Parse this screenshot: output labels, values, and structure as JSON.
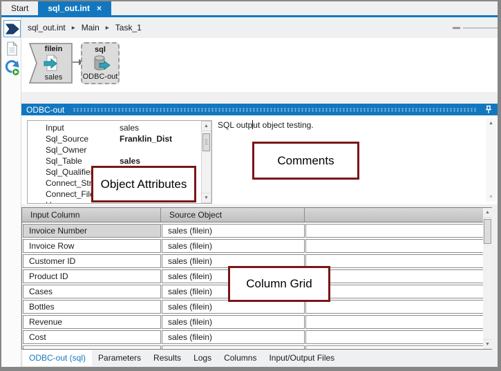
{
  "icons": {
    "close": "×",
    "scroll_up": "▲",
    "scroll_down": "▼",
    "breadcrumb_separator": "▸"
  },
  "colors": {
    "accent_blue": "#1377bf",
    "annotation_red": "#7a1517",
    "teal_arrow": "#2fa3b5"
  },
  "top_tabs": [
    {
      "label": "Start",
      "active": false
    },
    {
      "label": "sql_out.int",
      "active": true
    }
  ],
  "breadcrumb": {
    "items": [
      "sql_out.int",
      "Main",
      "Task_1"
    ]
  },
  "toolbar": {
    "icons": [
      "run-flow-icon",
      "document-icon",
      "history-refresh-icon"
    ]
  },
  "canvas": {
    "nodes": [
      {
        "title": "filein",
        "label": "sales",
        "selected": false
      },
      {
        "title": "sql",
        "label": "ODBC-out",
        "selected": true
      }
    ]
  },
  "panel": {
    "title": "ODBC-out",
    "attributes": [
      {
        "name": "Input",
        "value": "sales",
        "bold": false
      },
      {
        "name": "Sql_Source",
        "value": "Franklin_Dist",
        "bold": true
      },
      {
        "name": "Sql_Owner",
        "value": "",
        "bold": false
      },
      {
        "name": "Sql_Table",
        "value": "sales",
        "bold": true
      },
      {
        "name": "Sql_Qualifier",
        "value": "",
        "bold": false
      },
      {
        "name": "Connect_Strin",
        "value": "",
        "bold": false
      },
      {
        "name": "Connect_File",
        "value": "",
        "bold": false
      },
      {
        "name": "U",
        "value": "",
        "bold": false,
        "partial": true
      }
    ],
    "comments": {
      "full_text": "SQL output object testing.",
      "before_caret": "SQL outp",
      "after_caret": "ut object testing."
    }
  },
  "grid": {
    "columns": [
      "Input Column",
      "Source Object",
      ""
    ],
    "rows": [
      {
        "input": "Invoice Number",
        "source": "sales (filein)",
        "selected": true
      },
      {
        "input": "Invoice Row",
        "source": "sales (filein)",
        "selected": false
      },
      {
        "input": "Customer ID",
        "source": "sales (filein)",
        "selected": false
      },
      {
        "input": "Product ID",
        "source": "sales (filein)",
        "selected": false
      },
      {
        "input": "Cases",
        "source": "sales (filein)",
        "selected": false
      },
      {
        "input": "Bottles",
        "source": "sales (filein)",
        "selected": false
      },
      {
        "input": "Revenue",
        "source": "sales (filein)",
        "selected": false
      },
      {
        "input": "Cost",
        "source": "sales (filein)",
        "selected": false
      }
    ]
  },
  "bottom_tabs": [
    {
      "label": "ODBC-out (sql)",
      "active": true
    },
    {
      "label": "Parameters",
      "active": false
    },
    {
      "label": "Results",
      "active": false
    },
    {
      "label": "Logs",
      "active": false
    },
    {
      "label": "Columns",
      "active": false
    },
    {
      "label": "Input/Output Files",
      "active": false
    }
  ],
  "annotations": [
    {
      "label": "Object Attributes"
    },
    {
      "label": "Comments"
    },
    {
      "label": "Column Grid"
    }
  ]
}
